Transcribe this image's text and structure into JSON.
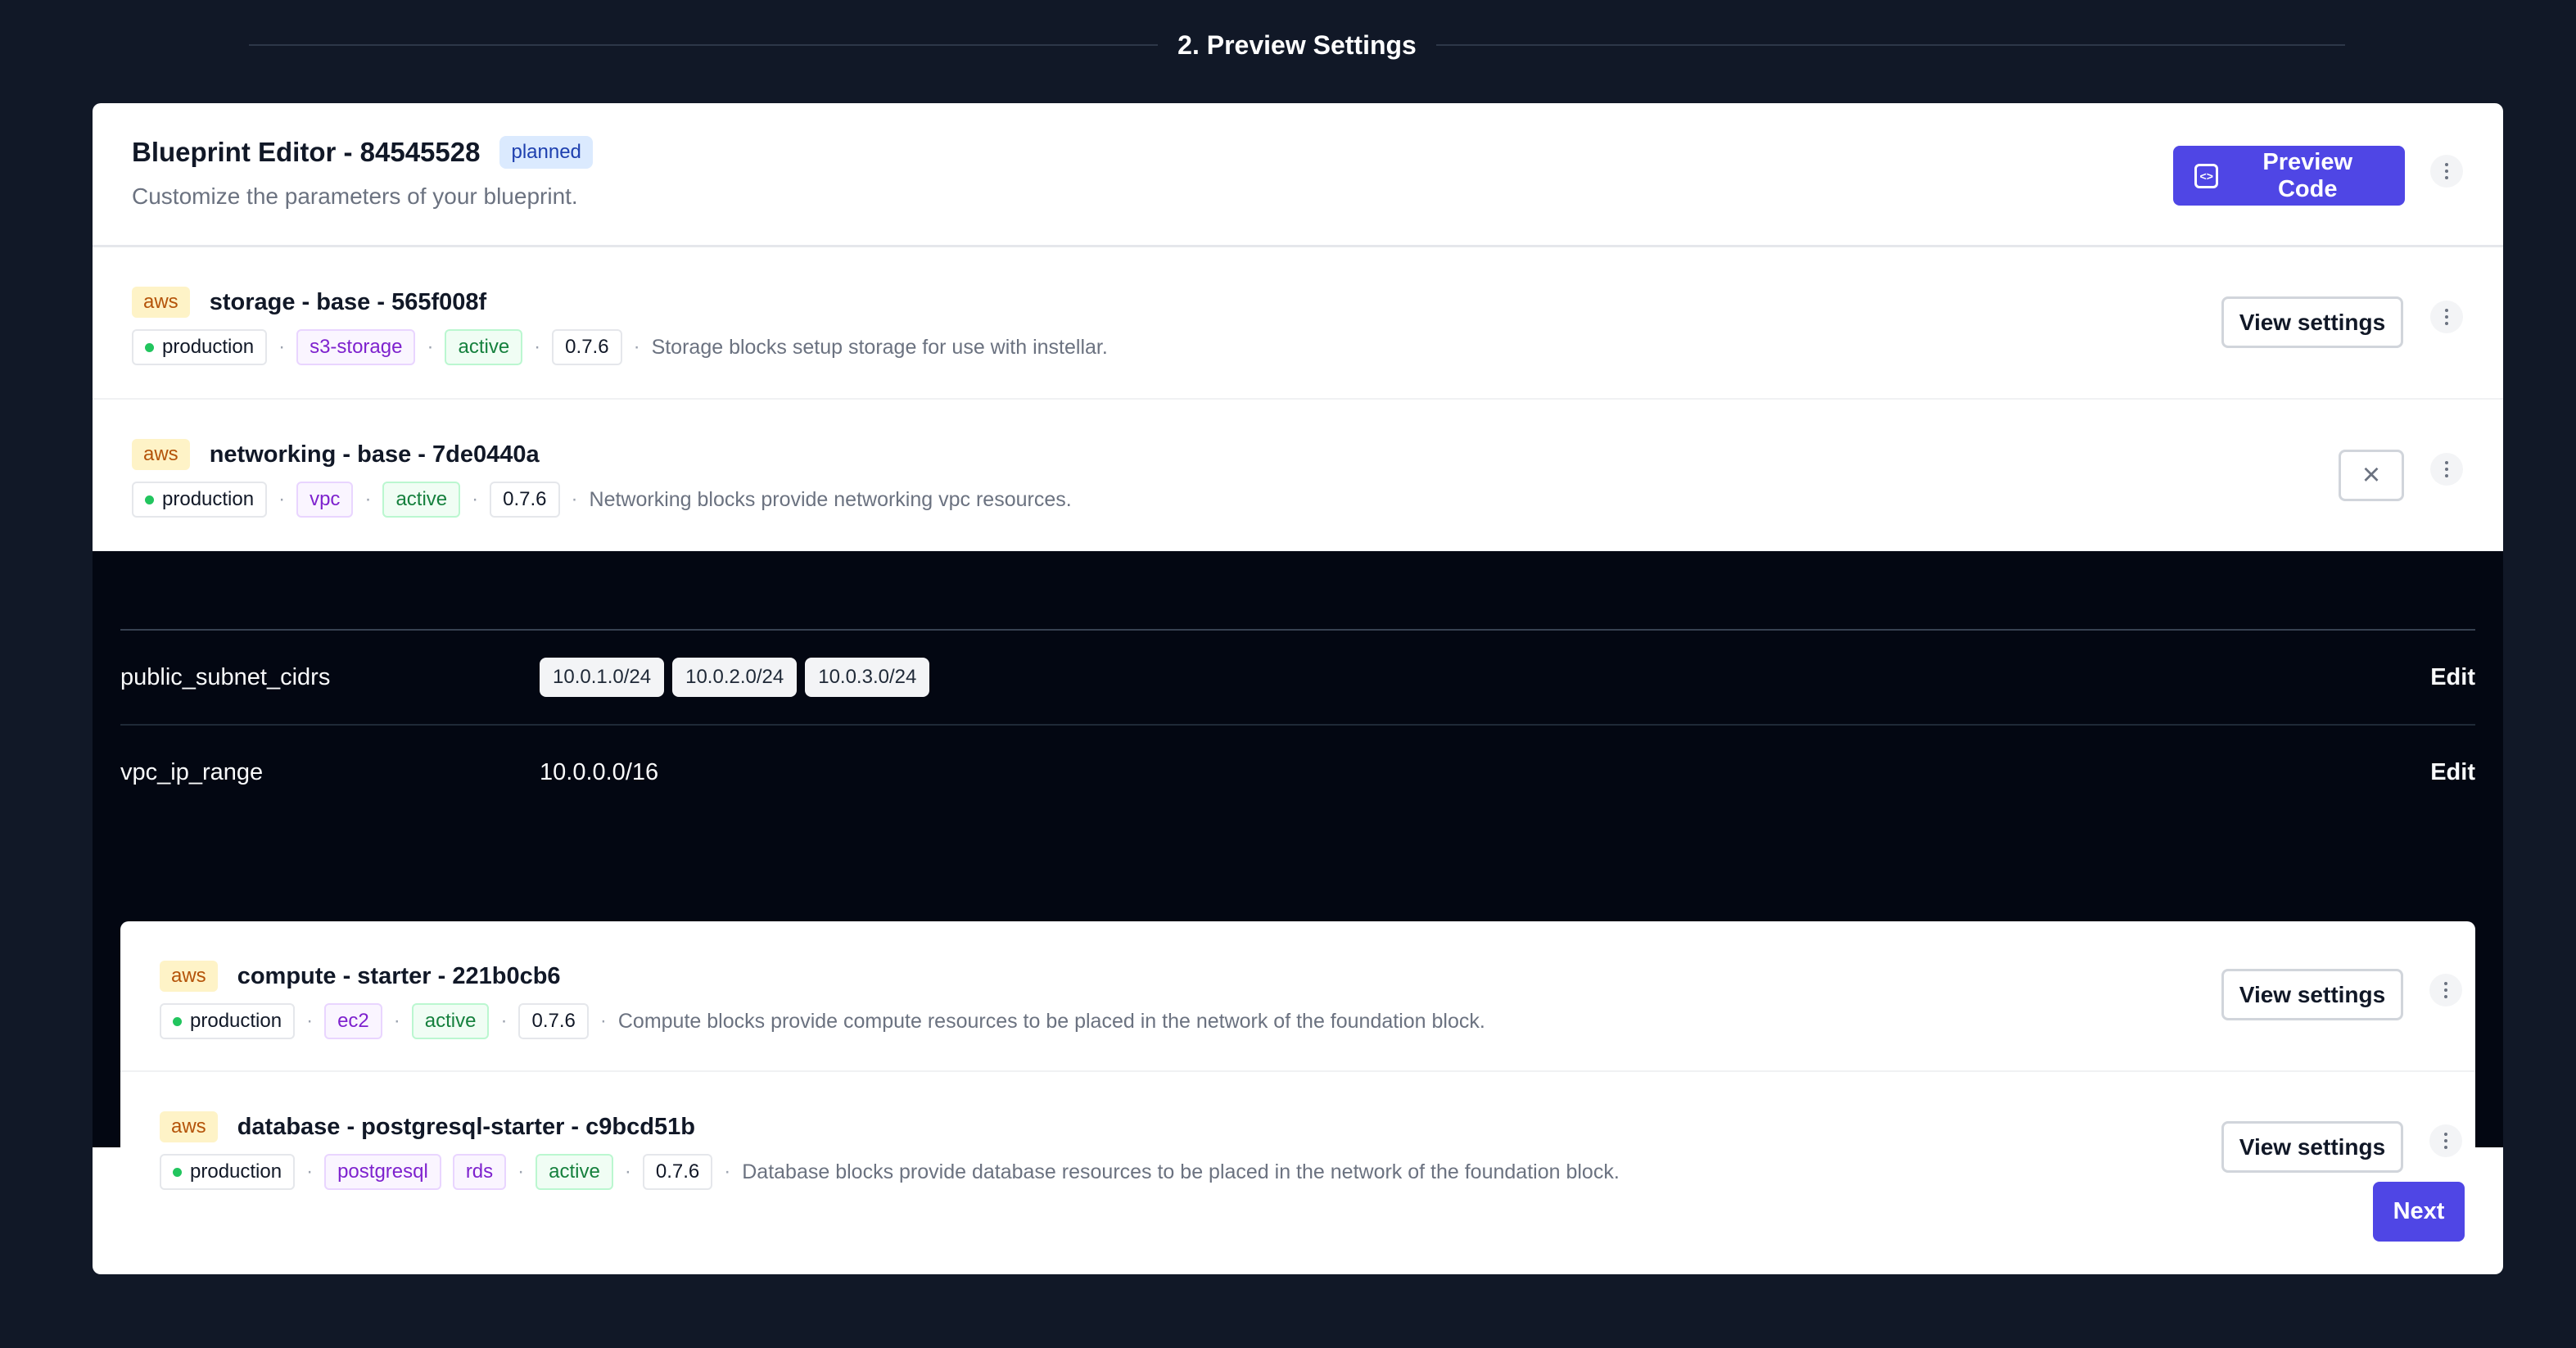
{
  "step": {
    "title": "2. Preview Settings"
  },
  "editor": {
    "title": "Blueprint Editor - 84545528",
    "status": "planned",
    "subtitle": "Customize the parameters of your blueprint.",
    "preview_label": "Preview Code"
  },
  "blocks": [
    {
      "provider": "aws",
      "name": "storage - base - 565f008f",
      "env": "production",
      "tags": [
        "s3-storage"
      ],
      "status": "active",
      "version": "0.7.6",
      "description": "Storage blocks setup storage for use with instellar.",
      "action_label": "View settings"
    },
    {
      "provider": "aws",
      "name": "networking - base - 7de0440a",
      "env": "production",
      "tags": [
        "vpc"
      ],
      "status": "active",
      "version": "0.7.6",
      "description": "Networking blocks provide networking vpc resources.",
      "action_label": ""
    }
  ],
  "settings": [
    {
      "key": "public_subnet_cidrs",
      "values": [
        "10.0.1.0/24",
        "10.0.2.0/24",
        "10.0.3.0/24"
      ],
      "edit_label": "Edit"
    },
    {
      "key": "vpc_ip_range",
      "value": "10.0.0.0/16",
      "edit_label": "Edit"
    }
  ],
  "nested_blocks": [
    {
      "provider": "aws",
      "name": "compute - starter - 221b0cb6",
      "env": "production",
      "tags": [
        "ec2"
      ],
      "status": "active",
      "version": "0.7.6",
      "description": "Compute blocks provide compute resources to be placed in the network of the foundation block.",
      "action_label": "View settings"
    },
    {
      "provider": "aws",
      "name": "database - postgresql-starter - c9bcd51b",
      "env": "production",
      "tags": [
        "postgresql",
        "rds"
      ],
      "status": "active",
      "version": "0.7.6",
      "description": "Database blocks provide database resources to be placed in the network of the foundation block.",
      "action_label": "View settings"
    }
  ],
  "footer": {
    "next_label": "Next"
  },
  "colors": {
    "background": "#111827",
    "accent": "#4f46e5",
    "panel_dark": "#030712"
  },
  "icons": {
    "code": "code-icon",
    "kebab": "kebab-menu-icon",
    "close": "close-icon",
    "dot": "status-dot-icon"
  }
}
